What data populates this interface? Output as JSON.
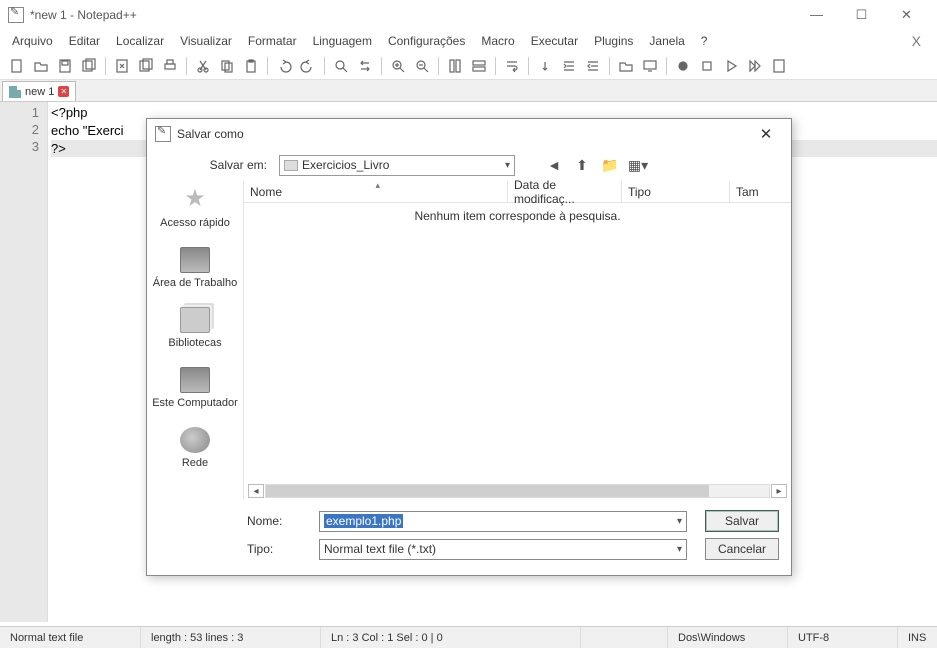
{
  "title": "*new 1 - Notepad++",
  "window_controls": {
    "min": "—",
    "max": "☐",
    "close": "✕"
  },
  "menu": [
    "Arquivo",
    "Editar",
    "Localizar",
    "Visualizar",
    "Formatar",
    "Linguagem",
    "Configurações",
    "Macro",
    "Executar",
    "Plugins",
    "Janela",
    "?"
  ],
  "tab": {
    "label": "new 1",
    "close": "✕"
  },
  "code": {
    "lines": [
      "1",
      "2",
      "3"
    ],
    "l1": "<?php",
    "l2": "echo \"Exerci",
    "l3": "?>                                                                                         "
  },
  "status": {
    "filetype": "Normal text file",
    "length": "length : 53    lines : 3",
    "pos": "Ln : 3    Col : 1    Sel : 0 | 0",
    "eol": "Dos\\Windows",
    "enc": "UTF-8",
    "ins": "INS"
  },
  "dialog": {
    "title": "Salvar como",
    "savein_label": "Salvar em:",
    "savein_value": "Exercicios_Livro",
    "columns": {
      "name": "Nome",
      "date": "Data de modificaç...",
      "type": "Tipo",
      "size": "Tam"
    },
    "empty_message": "Nenhum item corresponde à pesquisa.",
    "places": {
      "quick": "Acesso rápido",
      "desktop": "Área de Trabalho",
      "libs": "Bibliotecas",
      "thispc": "Este Computador",
      "network": "Rede"
    },
    "filename_label": "Nome:",
    "filename_value": "exemplo1.php",
    "filetype_label": "Tipo:",
    "filetype_value": "Normal text file (*.txt)",
    "save_btn": "Salvar",
    "cancel_btn": "Cancelar"
  }
}
